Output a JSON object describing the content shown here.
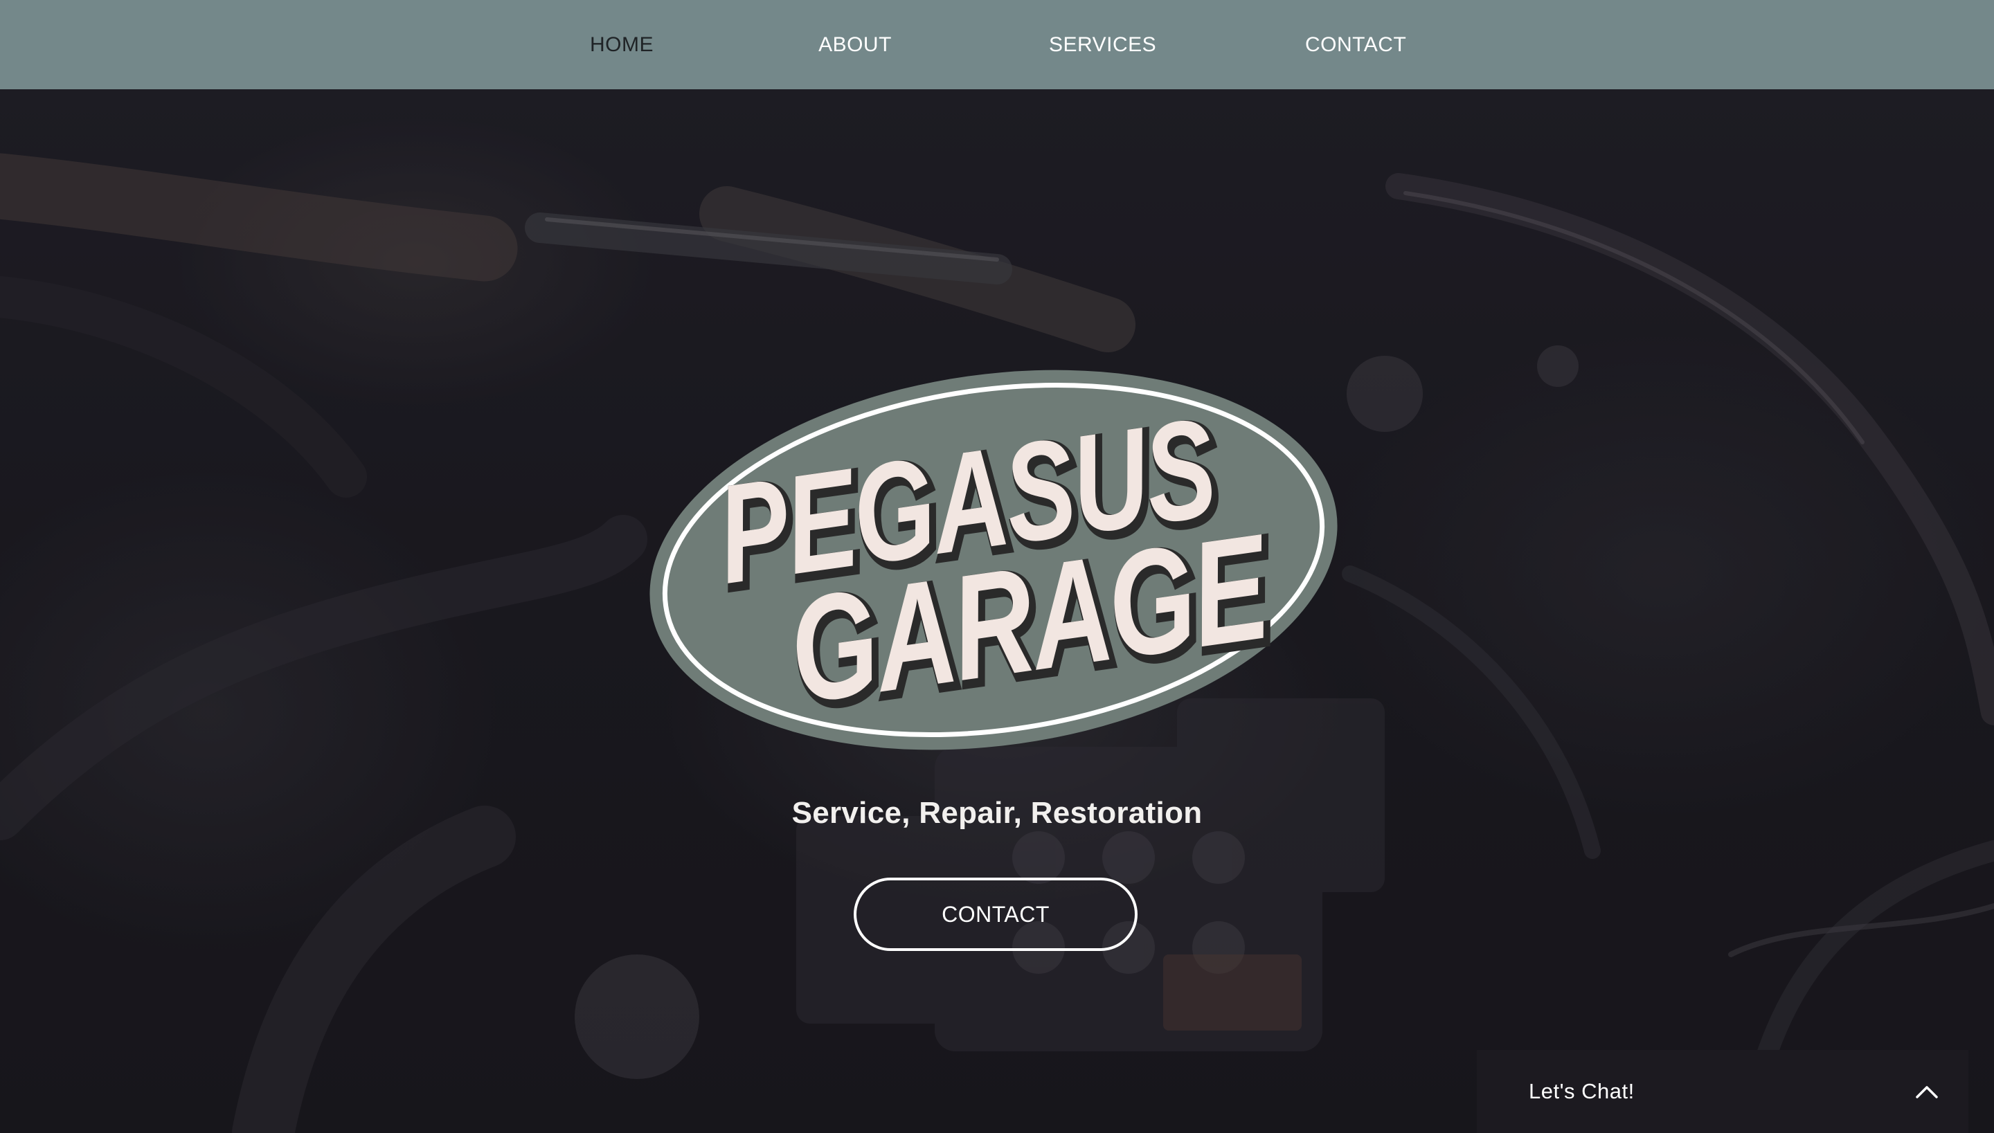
{
  "nav": {
    "items": [
      {
        "label": "HOME",
        "active": true
      },
      {
        "label": "ABOUT",
        "active": false
      },
      {
        "label": "SERVICES",
        "active": false
      },
      {
        "label": "CONTACT",
        "active": false
      }
    ]
  },
  "logo": {
    "line1": "PEGASUS",
    "line2": "GARAGE"
  },
  "hero": {
    "tagline": "Service, Repair, Restoration",
    "cta_label": "CONTACT",
    "background": "engine-bay-photo"
  },
  "chat": {
    "label": "Let's Chat!",
    "icon": "chevron-up-icon"
  },
  "colors": {
    "nav_bg": "#74888a",
    "nav_active_text": "#1f2326",
    "nav_text": "#ffffff",
    "logo_oval": "#6f7c77",
    "logo_letter": "#f2e6e1",
    "hero_bg": "#1e1c22",
    "chat_bg": "#1c1a20"
  }
}
